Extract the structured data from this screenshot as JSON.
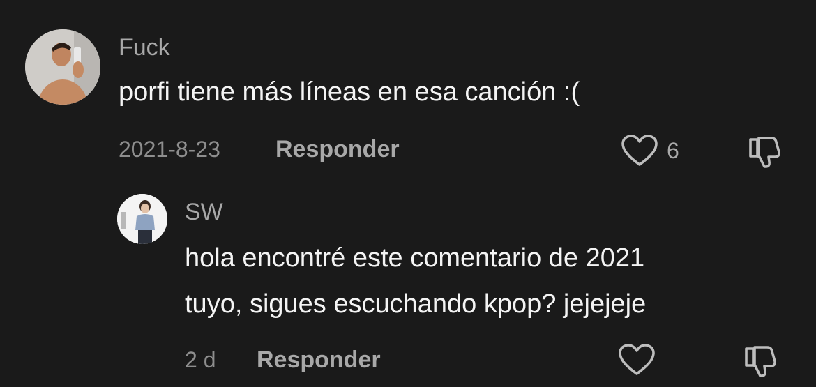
{
  "comments": [
    {
      "username": "Fuck",
      "text_lines": [
        "porfi tiene más líneas en esa canción :("
      ],
      "date": "2021-8-23",
      "reply_label": "Responder",
      "likes": "6"
    }
  ],
  "reply": {
    "username": "SW",
    "text_lines": [
      "hola encontré este comentario de 2021",
      "tuyo, sigues escuchando kpop? jejejeje"
    ],
    "date": "2 d",
    "reply_label": "Responder"
  },
  "colors": {
    "background": "#1a1a1a",
    "username": "#a9a9a9",
    "text": "#f4f4f4",
    "meta": "#8e8e8e"
  },
  "icons": [
    "heart-outline-icon",
    "thumbs-down-icon"
  ]
}
